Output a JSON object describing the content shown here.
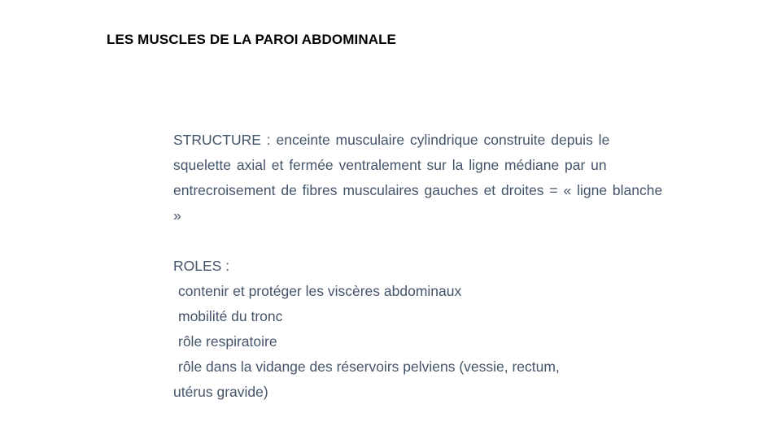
{
  "slide": {
    "title": "LES MUSCLES DE LA PAROI ABDOMINALE",
    "text_color": "#44546a",
    "title_color": "#000000",
    "structure": {
      "label": "STRUCTURE",
      "text": " : enceinte musculaire cylindrique construite depuis le squelette axial et fermée ventralement sur la ligne médiane par un entrecroisement de fibres musculaires gauches et droites = « ligne blanche »"
    },
    "roles": {
      "heading": "ROLES :",
      "items": [
        "contenir et protéger les viscères abdominaux",
        "mobilité du tronc",
        "rôle respiratoire",
        "rôle dans la vidange des réservoirs pelviens (vessie, rectum,"
      ],
      "continuation": "utérus gravide)"
    }
  }
}
